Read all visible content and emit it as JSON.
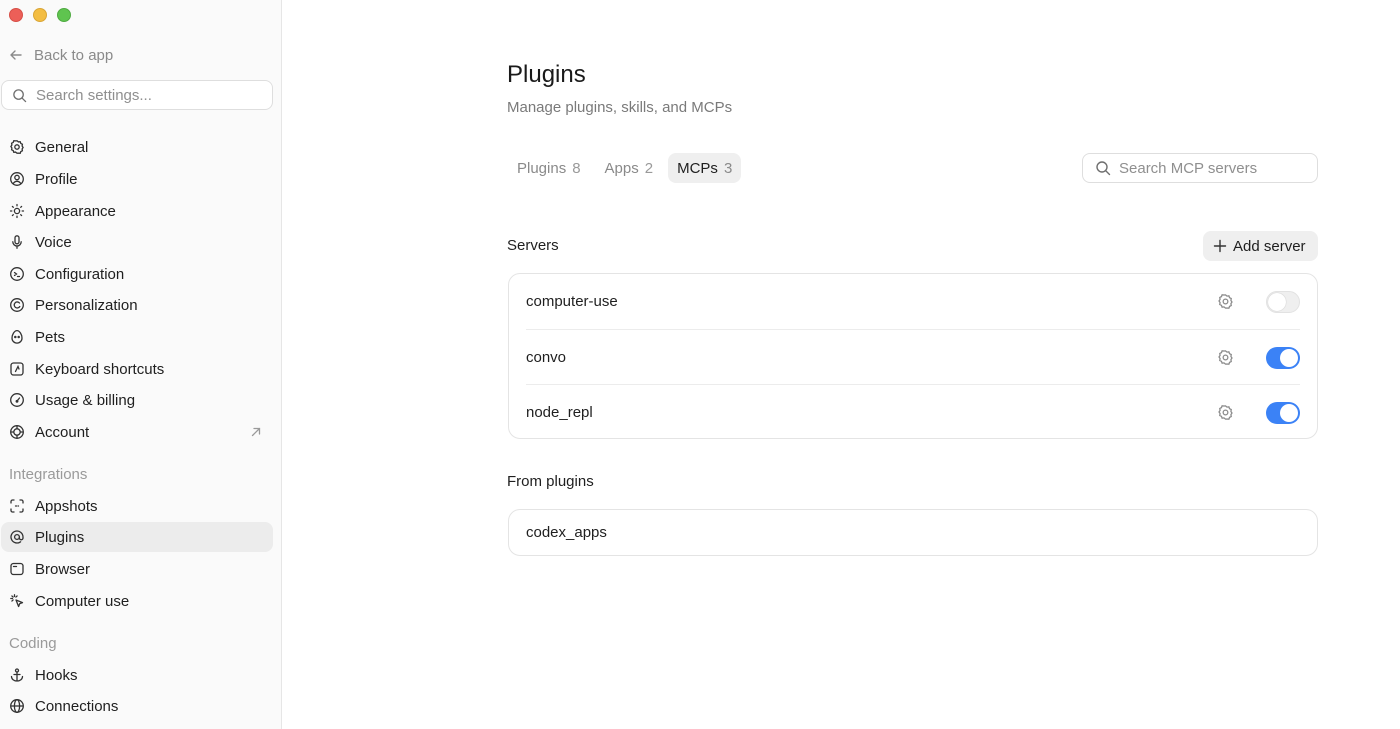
{
  "sidebar": {
    "back_label": "Back to app",
    "search_placeholder": "Search settings...",
    "items": [
      {
        "label": "General",
        "icon": "gear-icon"
      },
      {
        "label": "Profile",
        "icon": "user-circle-icon"
      },
      {
        "label": "Appearance",
        "icon": "sun-icon"
      },
      {
        "label": "Voice",
        "icon": "microphone-icon"
      },
      {
        "label": "Configuration",
        "icon": "config-icon"
      },
      {
        "label": "Personalization",
        "icon": "personalization-icon"
      },
      {
        "label": "Pets",
        "icon": "egg-icon"
      },
      {
        "label": "Keyboard shortcuts",
        "icon": "keyboard-shortcut-icon"
      },
      {
        "label": "Usage & billing",
        "icon": "gauge-icon"
      },
      {
        "label": "Account",
        "icon": "account-icon"
      }
    ],
    "integrations_label": "Integrations",
    "integrations": [
      {
        "label": "Appshots",
        "icon": "appshots-icon"
      },
      {
        "label": "Plugins",
        "icon": "at-icon",
        "active": true
      },
      {
        "label": "Browser",
        "icon": "browser-icon"
      },
      {
        "label": "Computer use",
        "icon": "cursor-click-icon"
      }
    ],
    "coding_label": "Coding",
    "coding": [
      {
        "label": "Hooks",
        "icon": "anchor-icon"
      },
      {
        "label": "Connections",
        "icon": "globe-icon"
      }
    ]
  },
  "main": {
    "title": "Plugins",
    "subtitle": "Manage plugins, skills, and MCPs",
    "tabs": [
      {
        "label": "Plugins",
        "count": "8"
      },
      {
        "label": "Apps",
        "count": "2"
      },
      {
        "label": "MCPs",
        "count": "3",
        "active": true
      }
    ],
    "search_placeholder": "Search MCP servers",
    "servers_label": "Servers",
    "add_server_label": "Add server",
    "servers": [
      {
        "name": "computer-use",
        "enabled": false
      },
      {
        "name": "convo",
        "enabled": true
      },
      {
        "name": "node_repl",
        "enabled": true
      }
    ],
    "from_plugins_label": "From plugins",
    "plugin_servers": [
      {
        "name": "codex_apps"
      }
    ]
  },
  "colors": {
    "accent": "#3b82f6",
    "close": "#ec5f58",
    "minimize": "#f3bd42",
    "maximize": "#5fc44f"
  }
}
